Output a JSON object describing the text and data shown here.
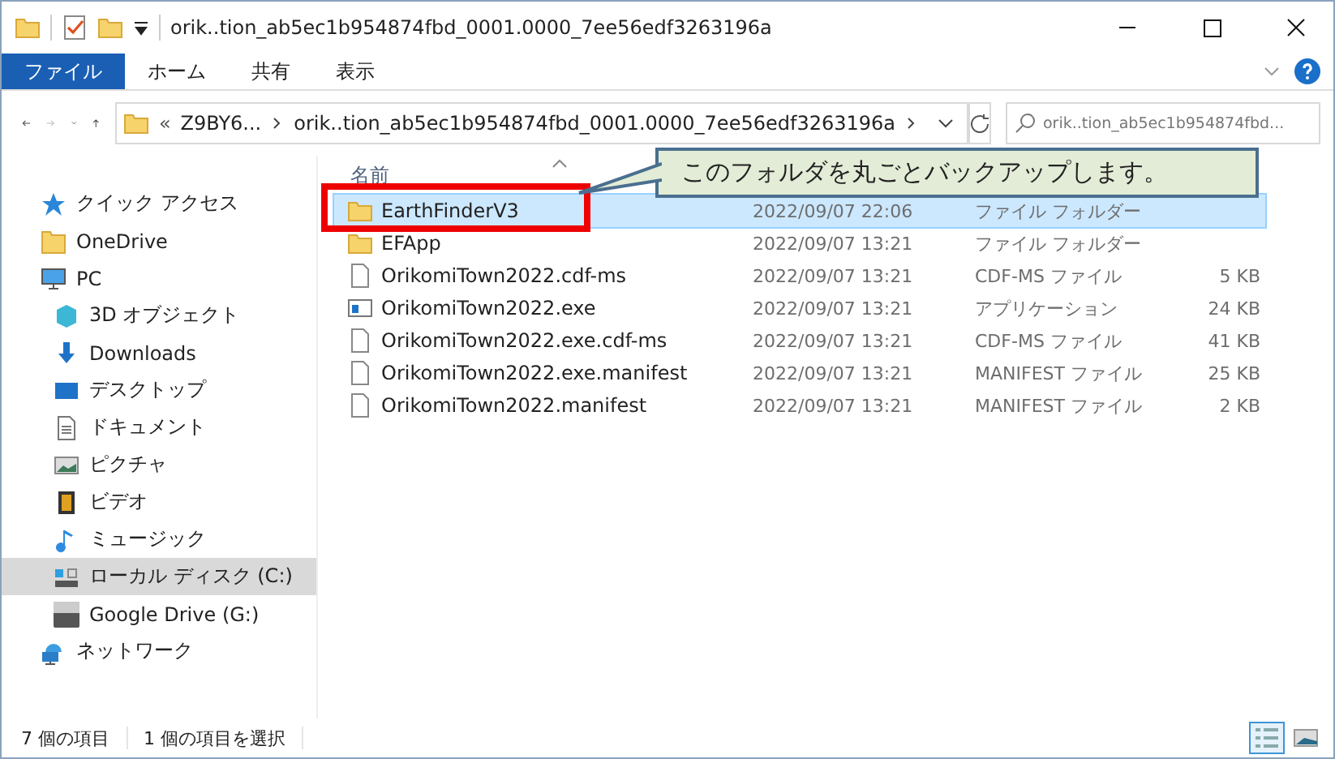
{
  "window": {
    "title": "orik..tion_ab5ec1b954874fbd_0001.0000_7ee56edf3263196a"
  },
  "ribbon_tabs": [
    {
      "label": "ファイル",
      "selected": true
    },
    {
      "label": "ホーム",
      "selected": false
    },
    {
      "label": "共有",
      "selected": false
    },
    {
      "label": "表示",
      "selected": false
    }
  ],
  "address": {
    "overflow": "«",
    "crumbs": [
      "Z9BY6...",
      "orik..tion_ab5ec1b954874fbd_0001.0000_7ee56edf3263196a"
    ]
  },
  "search": {
    "placeholder": "orik..tion_ab5ec1b954874fbd..."
  },
  "sidebar": {
    "items": [
      {
        "label": "クイック アクセス",
        "kind": "star",
        "selected": false
      },
      {
        "label": "OneDrive",
        "kind": "folder",
        "selected": false
      },
      {
        "label": "PC",
        "kind": "pc",
        "selected": false,
        "children": [
          {
            "label": "3D オブジェクト",
            "kind": "cube",
            "selected": false
          },
          {
            "label": "Downloads",
            "kind": "download",
            "selected": false
          },
          {
            "label": "デスクトップ",
            "kind": "desktop",
            "selected": false
          },
          {
            "label": "ドキュメント",
            "kind": "document",
            "selected": false
          },
          {
            "label": "ピクチャ",
            "kind": "picture",
            "selected": false
          },
          {
            "label": "ビデオ",
            "kind": "video",
            "selected": false
          },
          {
            "label": "ミュージック",
            "kind": "music",
            "selected": false
          },
          {
            "label": "ローカル ディスク (C:)",
            "kind": "disk",
            "selected": true
          },
          {
            "label": "Google Drive (G:)",
            "kind": "drive",
            "selected": false
          }
        ]
      },
      {
        "label": "ネットワーク",
        "kind": "network",
        "selected": false
      }
    ]
  },
  "file_list": {
    "columns": [
      "名前"
    ],
    "rows": [
      {
        "name": "EarthFinderV3",
        "date": "2022/09/07 22:06",
        "type": "ファイル フォルダー",
        "size": "",
        "kind": "folder",
        "selected": true
      },
      {
        "name": "EFApp",
        "date": "2022/09/07 13:21",
        "type": "ファイル フォルダー",
        "size": "",
        "kind": "folder",
        "selected": false
      },
      {
        "name": "OrikomiTown2022.cdf-ms",
        "date": "2022/09/07 13:21",
        "type": "CDF-MS ファイル",
        "size": "5 KB",
        "kind": "file",
        "selected": false
      },
      {
        "name": "OrikomiTown2022.exe",
        "date": "2022/09/07 13:21",
        "type": "アプリケーション",
        "size": "24 KB",
        "kind": "exe",
        "selected": false
      },
      {
        "name": "OrikomiTown2022.exe.cdf-ms",
        "date": "2022/09/07 13:21",
        "type": "CDF-MS ファイル",
        "size": "41 KB",
        "kind": "file",
        "selected": false
      },
      {
        "name": "OrikomiTown2022.exe.manifest",
        "date": "2022/09/07 13:21",
        "type": "MANIFEST ファイル",
        "size": "25 KB",
        "kind": "file",
        "selected": false
      },
      {
        "name": "OrikomiTown2022.manifest",
        "date": "2022/09/07 13:21",
        "type": "MANIFEST ファイル",
        "size": "2 KB",
        "kind": "file",
        "selected": false
      }
    ]
  },
  "callout": {
    "text": "このフォルダを丸ごとバックアップします。"
  },
  "status_bar": {
    "items": [
      "7 個の項目",
      "1 個の項目を選択"
    ],
    "views": [
      {
        "kind": "details",
        "selected": true
      },
      {
        "kind": "tiles",
        "selected": false
      }
    ]
  }
}
